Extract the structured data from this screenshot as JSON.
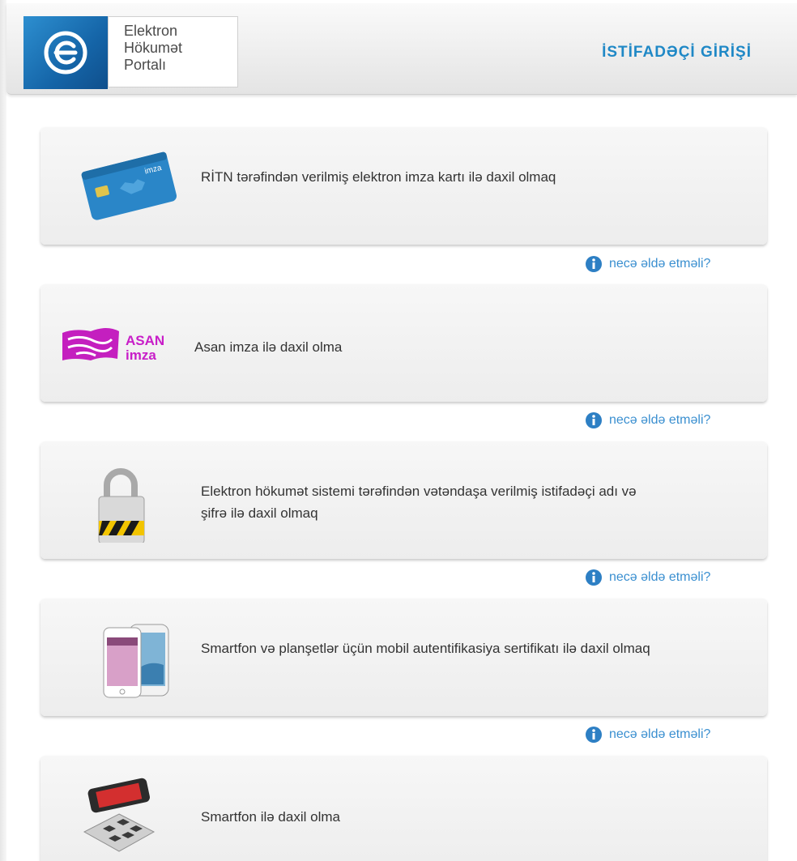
{
  "header": {
    "logo_lines": [
      "Elektron",
      "Hökumət",
      "Portalı"
    ],
    "title": "İSTİFADƏÇİ GİRİŞİ"
  },
  "methods": [
    {
      "text": "RİTN tərəfindən verilmiş elektron imza kartı ilə daxil olmaq",
      "icon": "id-card-icon",
      "card_label": "imza"
    },
    {
      "text": "Asan imza ilə daxil olma",
      "icon": "asan-imza-logo",
      "logo_line1": "ASAN",
      "logo_line2": "imza"
    },
    {
      "text": "Elektron hökumət sistemi tərəfindən vətəndaşa verilmiş istifadəçi adı və şifrə ilə daxil olmaq",
      "icon": "padlock-icon"
    },
    {
      "text": "Smartfon və planşetlər üçün mobil autentifikasiya sertifikatı ilə daxil olmaq",
      "icon": "smartphones-icon"
    },
    {
      "text": "Smartfon ilə daxil olma",
      "icon": "qr-phone-icon"
    }
  ],
  "help_link": "necə əldə etməli?",
  "colors": {
    "accent": "#1f88c6",
    "link": "#3a8fd0",
    "asan": "#c81ec8"
  }
}
